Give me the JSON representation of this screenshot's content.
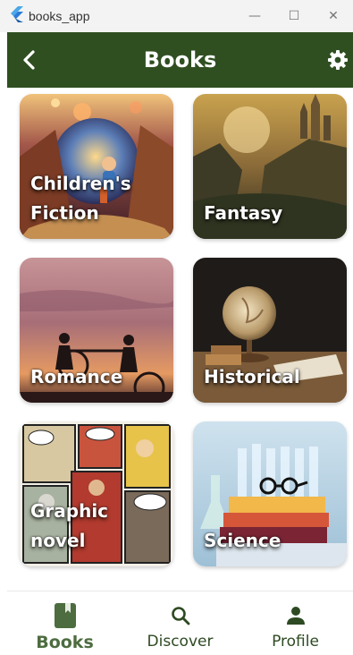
{
  "window": {
    "app_title": "books_app",
    "minimize_glyph": "—",
    "maximize_glyph": "☐",
    "close_glyph": "✕"
  },
  "appbar": {
    "title": "Books",
    "back_icon": "chevron-left-icon",
    "settings_icon": "gear-icon",
    "background_color": "#2f4f21"
  },
  "categories": [
    {
      "label": "Children's Fiction"
    },
    {
      "label": "Fantasy"
    },
    {
      "label": "Romance"
    },
    {
      "label": "Historical"
    },
    {
      "label": "Graphic novel"
    },
    {
      "label": "Science"
    }
  ],
  "bottom_nav": {
    "items": [
      {
        "label": "Books",
        "icon": "book-icon",
        "active": true
      },
      {
        "label": "Discover",
        "icon": "search-icon",
        "active": false
      },
      {
        "label": "Profile",
        "icon": "person-icon",
        "active": false
      }
    ],
    "active_color": "#4d6c3f"
  }
}
